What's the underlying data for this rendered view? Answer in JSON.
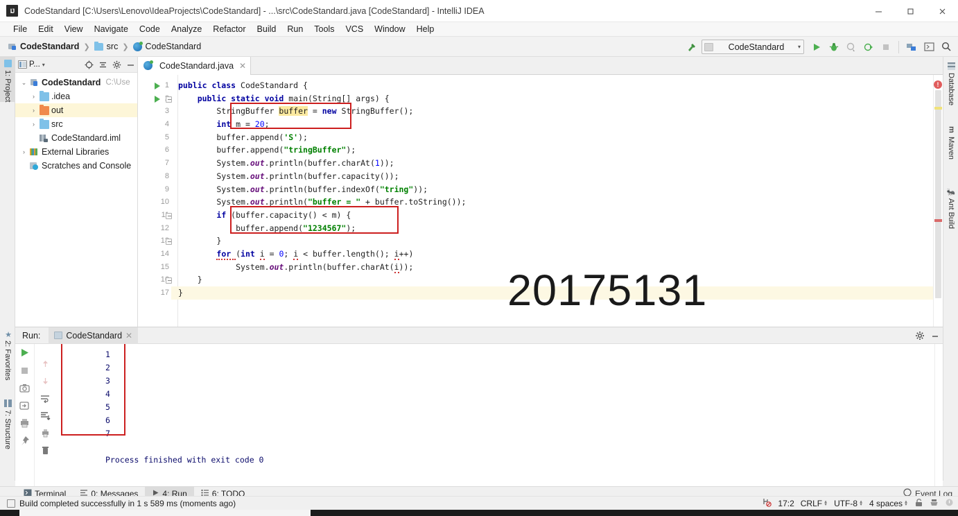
{
  "window": {
    "title": "CodeStandard [C:\\Users\\Lenovo\\IdeaProjects\\CodeStandard] - ...\\src\\CodeStandard.java [CodeStandard] - IntelliJ IDEA",
    "minimize": "—",
    "maximize": "❐",
    "close": "✕"
  },
  "menubar": [
    {
      "label": "File"
    },
    {
      "label": "Edit"
    },
    {
      "label": "View"
    },
    {
      "label": "Navigate"
    },
    {
      "label": "Code"
    },
    {
      "label": "Analyze"
    },
    {
      "label": "Refactor"
    },
    {
      "label": "Build"
    },
    {
      "label": "Run"
    },
    {
      "label": "Tools"
    },
    {
      "label": "VCS"
    },
    {
      "label": "Window"
    },
    {
      "label": "Help"
    }
  ],
  "breadcrumbs": [
    {
      "label": "CodeStandard",
      "icon": "module-icon"
    },
    {
      "label": "src",
      "icon": "folder-icon"
    },
    {
      "label": "CodeStandard",
      "icon": "java-class-icon"
    }
  ],
  "toolbar": {
    "run_config": "CodeStandard",
    "config_arrow": "▾",
    "icons": [
      "build-hammer-icon",
      "run-icon",
      "debug-icon",
      "run-coverage-icon",
      "run-profiler-icon",
      "stop-icon",
      "project-structure-icon",
      "terminal-icon",
      "search-everywhere-icon"
    ]
  },
  "left_strip": [
    {
      "label": "1: Project",
      "selected": true
    },
    {
      "label": "2: Favorites",
      "selected": false
    },
    {
      "label": "7: Structure",
      "selected": false
    }
  ],
  "right_strip": [
    {
      "label": "Database"
    },
    {
      "label": "Maven"
    },
    {
      "label": "Ant Build"
    }
  ],
  "project_panel": {
    "title": "P...",
    "title_arrow": "▾",
    "buttons": [
      "locate-icon",
      "collapse-all-icon",
      "settings-gear-icon",
      "hide-icon"
    ],
    "tree": [
      {
        "label": "CodeStandard",
        "path": "C:\\Use",
        "arrow": "⌄",
        "icon": "module-icon",
        "bold": true,
        "indent": 0,
        "highlight": false
      },
      {
        "label": ".idea",
        "arrow": "›",
        "icon": "folder-icon",
        "indent": 1,
        "highlight": false
      },
      {
        "label": "out",
        "arrow": "›",
        "icon": "folder-orange-icon",
        "indent": 1,
        "highlight": true
      },
      {
        "label": "src",
        "arrow": "›",
        "icon": "folder-icon",
        "indent": 1,
        "highlight": false
      },
      {
        "label": "CodeStandard.iml",
        "arrow": "",
        "icon": "iml-file-icon",
        "indent": 1,
        "highlight": false
      },
      {
        "label": "External Libraries",
        "arrow": "›",
        "icon": "libraries-icon",
        "indent": 0,
        "highlight": false
      },
      {
        "label": "Scratches and Console",
        "arrow": "",
        "icon": "scratches-icon",
        "indent": 0,
        "highlight": false
      }
    ]
  },
  "editor": {
    "tab": {
      "label": "CodeStandard.java",
      "close": "✕",
      "icon": "java-class-icon"
    },
    "breadcrumb": "CodeStandard",
    "watermark": "20175131",
    "error_badge": "!",
    "lines": [
      {
        "n": 1,
        "gutter": "run",
        "fold": false
      },
      {
        "n": 2,
        "gutter": "run",
        "fold": true
      },
      {
        "n": 3,
        "gutter": "",
        "fold": false
      },
      {
        "n": 4,
        "gutter": "",
        "fold": false
      },
      {
        "n": 5,
        "gutter": "",
        "fold": false
      },
      {
        "n": 6,
        "gutter": "",
        "fold": false
      },
      {
        "n": 7,
        "gutter": "",
        "fold": false
      },
      {
        "n": 8,
        "gutter": "",
        "fold": false
      },
      {
        "n": 9,
        "gutter": "",
        "fold": false
      },
      {
        "n": 10,
        "gutter": "",
        "fold": false
      },
      {
        "n": 11,
        "gutter": "",
        "fold": true
      },
      {
        "n": 12,
        "gutter": "",
        "fold": false
      },
      {
        "n": 13,
        "gutter": "",
        "fold": true
      },
      {
        "n": 14,
        "gutter": "",
        "fold": false
      },
      {
        "n": 15,
        "gutter": "",
        "fold": false
      },
      {
        "n": 16,
        "gutter": "",
        "fold": true
      },
      {
        "n": 17,
        "gutter": "",
        "fold": false
      }
    ],
    "code": [
      "public class CodeStandard {",
      "    public static void main(String[] args) {",
      "        StringBuffer buffer = new StringBuffer();",
      "        int m = 20;",
      "        buffer.append('S');",
      "        buffer.append(\"tringBuffer\");",
      "        System.out.println(buffer.charAt(1));",
      "        System.out.println(buffer.capacity());",
      "        System.out.println(buffer.indexOf(\"tring\"));",
      "        System.out.println(\"buffer = \" + buffer.toString());",
      "        if (buffer.capacity() < m) {",
      "            buffer.append(\"1234567\");",
      "        }",
      "        for (int i = 0; i < buffer.length(); i++)",
      "            System.out.println(buffer.charAt(i));",
      "    }",
      "}"
    ]
  },
  "run_panel": {
    "label": "Run:",
    "tab": "CodeStandard",
    "tab_close": "✕",
    "header_buttons": [
      "settings-gear-icon",
      "hide-icon"
    ],
    "left_tools": [
      "rerun-icon",
      "stop-icon",
      "capture-dump-icon",
      "export-icon",
      "print-icon",
      "pin-icon"
    ],
    "second_tools": [
      "scroll-up-icon",
      "scroll-down-icon",
      "soft-wrap-icon",
      "scroll-to-end-icon",
      "print-output-icon",
      "clear-all-icon"
    ],
    "output": [
      "1",
      "2",
      "3",
      "4",
      "5",
      "6",
      "7"
    ],
    "exit_message": "Process finished with exit code 0"
  },
  "bottom_tabs": [
    {
      "label": "Terminal",
      "icon": "terminal-icon",
      "selected": false
    },
    {
      "label": "0: Messages",
      "icon": "messages-icon",
      "selected": false
    },
    {
      "label": "4: Run",
      "icon": "run-icon",
      "selected": true
    },
    {
      "label": "6: TODO",
      "icon": "todo-icon",
      "selected": false
    }
  ],
  "event_log": "Event Log",
  "status": {
    "message": "Build completed successfully in 1 s 589 ms (moments ago)",
    "caret": "17:2",
    "line_sep": "CRLF",
    "encoding": "UTF-8",
    "indent": "4 spaces",
    "icons": [
      "git-branch-off-icon",
      "lock-icon",
      "inspector-icon",
      "notification-icon"
    ]
  },
  "colors": {
    "accent_red": "#cc1f1f",
    "keyword": "#0000a0",
    "string": "#008000",
    "number": "#0000ff",
    "field": "#660e7a",
    "highlight": "#fbe9a0"
  }
}
